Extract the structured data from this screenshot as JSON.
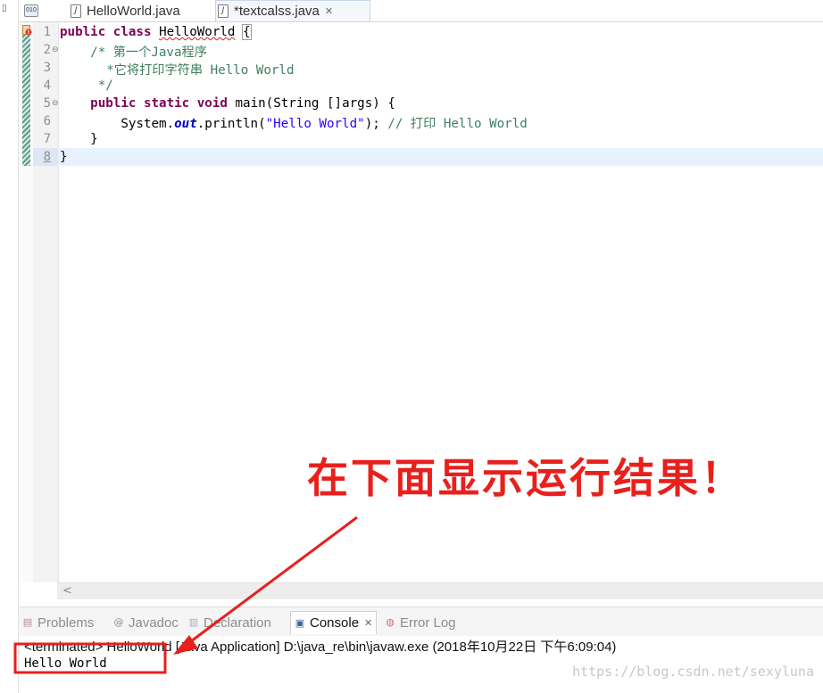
{
  "editor_tabs": [
    {
      "label": "HelloWorld.java",
      "icon": "java-file-icon"
    },
    {
      "label": "*textcalss.java",
      "icon": "java-file-icon",
      "close": "✕",
      "active": true
    }
  ],
  "class_file_icon_text": "010",
  "line_numbers": [
    "1",
    "2",
    "3",
    "4",
    "5",
    "6",
    "7",
    "8"
  ],
  "code": {
    "l1_kw1": "public",
    "l1_kw2": "class",
    "l1_name": "HelloWorld",
    "l1_brace": "{",
    "l2": "    /* 第一个Java程序",
    "l3": "    *它将打印字符串 Hello World",
    "l4": "     */",
    "l5_kw1": "public",
    "l5_kw2": "static",
    "l5_kw3": "void",
    "l5_rest": "main(String []args) {",
    "l6_pre": "System.",
    "l6_field": "out",
    "l6_mid": ".println(",
    "l6_str": "\"Hello World\"",
    "l6_end": "); ",
    "l6_comment": "// 打印 Hello World",
    "l7": "    }",
    "l8": "}"
  },
  "view_tabs": [
    {
      "label": "Problems",
      "icon": "problems-icon"
    },
    {
      "label": "Javadoc",
      "icon": "at-icon"
    },
    {
      "label": "Declaration",
      "icon": "declaration-icon"
    },
    {
      "label": "Console",
      "icon": "console-icon",
      "close": "✕",
      "active": true
    },
    {
      "label": "Error Log",
      "icon": "error-log-icon"
    }
  ],
  "console": {
    "terminated": "<terminated> HelloWorld [Java Application] D:\\java_re\\bin\\javaw.exe (2018年10月22日 下午6:09:04)",
    "output": "Hello World"
  },
  "annotation": "在下面显示运行结果！",
  "watermark": "https://blog.csdn.net/sexyluna",
  "colors": {
    "keyword": "#7f0055",
    "comment": "#3f7f5f",
    "string": "#2a00ff",
    "annotation_red": "#e8201c"
  }
}
